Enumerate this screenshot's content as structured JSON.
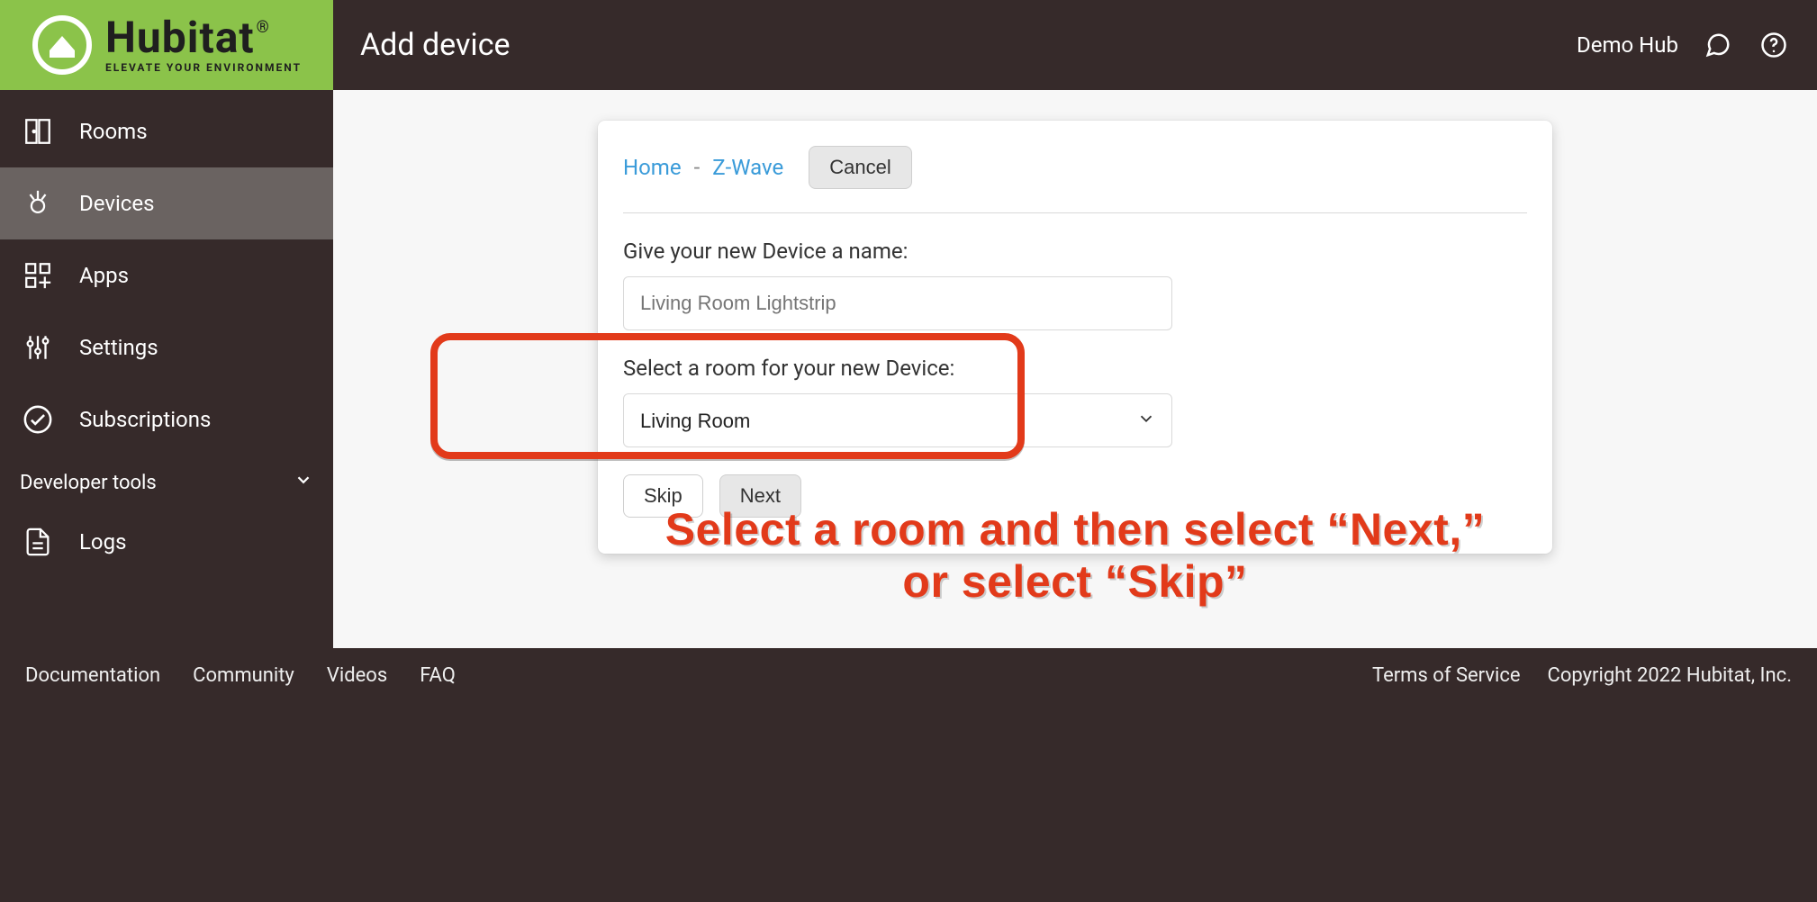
{
  "brand": {
    "name": "Hubitat",
    "reg": "®",
    "tagline": "ELEVATE YOUR ENVIRONMENT"
  },
  "header": {
    "title": "Add device",
    "hub_name": "Demo Hub"
  },
  "sidebar": {
    "items": [
      {
        "label": "Rooms"
      },
      {
        "label": "Devices"
      },
      {
        "label": "Apps"
      },
      {
        "label": "Settings"
      },
      {
        "label": "Subscriptions"
      }
    ],
    "group_label": "Developer tools",
    "logs_label": "Logs"
  },
  "breadcrumb": {
    "home": "Home",
    "zwave": "Z-Wave",
    "sep": "-"
  },
  "buttons": {
    "cancel": "Cancel",
    "skip": "Skip",
    "next": "Next"
  },
  "form": {
    "name_label": "Give your new Device a name:",
    "name_placeholder": "Living Room Lightstrip",
    "room_label": "Select a room for your new Device:",
    "room_value": "Living Room"
  },
  "annotation": {
    "line1": "Select a room and then select “Next,”",
    "line2": "or select “Skip”"
  },
  "footer": {
    "left": [
      "Documentation",
      "Community",
      "Videos",
      "FAQ"
    ],
    "right": [
      "Terms of Service",
      "Copyright 2022 Hubitat, Inc."
    ]
  }
}
